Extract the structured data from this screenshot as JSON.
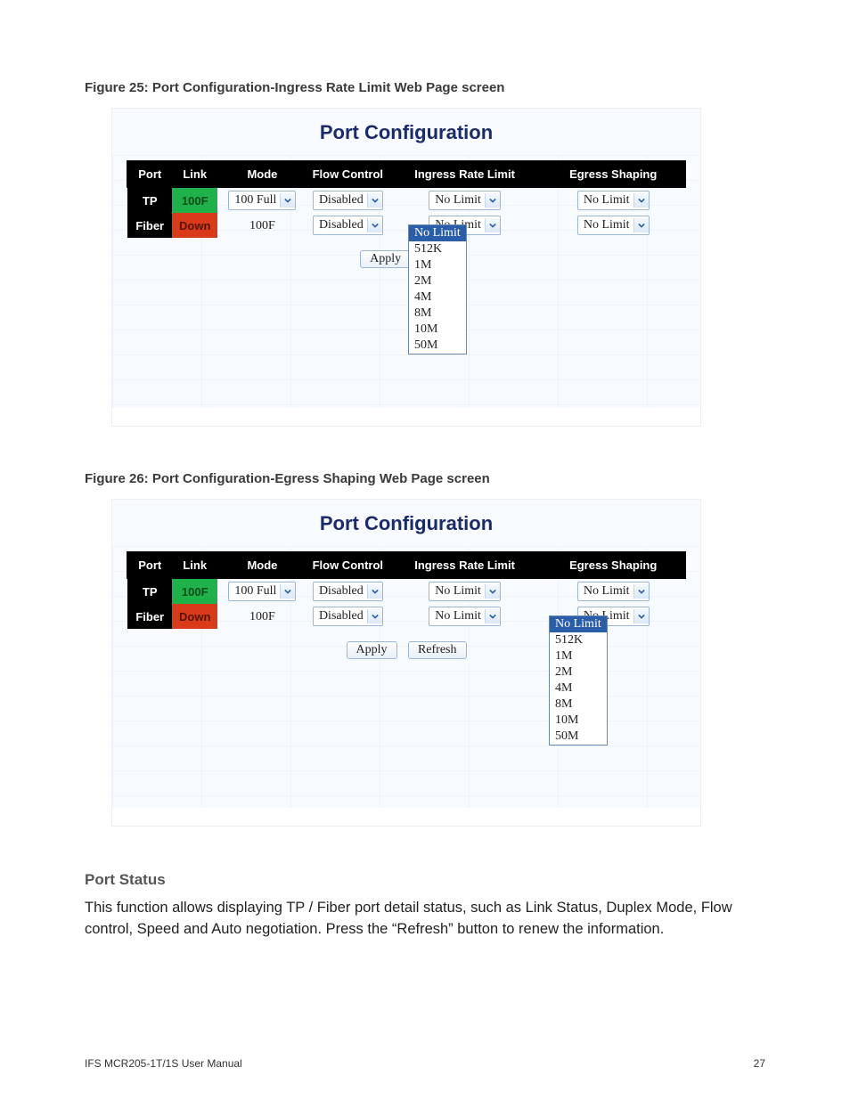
{
  "captions": {
    "fig25": "Figure 25: Port Configuration-Ingress Rate Limit Web Page screen",
    "fig26": "Figure 26: Port Configuration-Egress Shaping Web Page screen"
  },
  "panel": {
    "title": "Port Configuration",
    "headers": {
      "port": "Port",
      "link": "Link",
      "mode": "Mode",
      "flow": "Flow Control",
      "ingress": "Ingress Rate Limit",
      "egress": "Egress Shaping"
    },
    "rows": {
      "tp": {
        "port": "TP",
        "link": "100F",
        "mode": "100 Full",
        "flow": "Disabled",
        "ingress": "No Limit",
        "egress": "No Limit"
      },
      "fiber": {
        "port": "Fiber",
        "link": "Down",
        "mode": "100F",
        "flow": "Disabled",
        "ingress": "No Limit",
        "egress": "No Limit"
      }
    },
    "buttons": {
      "apply": "Apply",
      "refresh": "Refresh",
      "refresh_trunc": "Ref"
    },
    "dropdown_options": [
      "No Limit",
      "512K",
      "1M",
      "2M",
      "4M",
      "8M",
      "10M",
      "50M"
    ]
  },
  "section": {
    "title": "Port Status",
    "body": "This function allows displaying TP / Fiber port detail status, such as Link Status, Duplex Mode, Flow control, Speed and Auto negotiation. Press the “Refresh” button to renew the information."
  },
  "footer": {
    "left": "IFS MCR205-1T/1S User Manual",
    "right": "27"
  }
}
